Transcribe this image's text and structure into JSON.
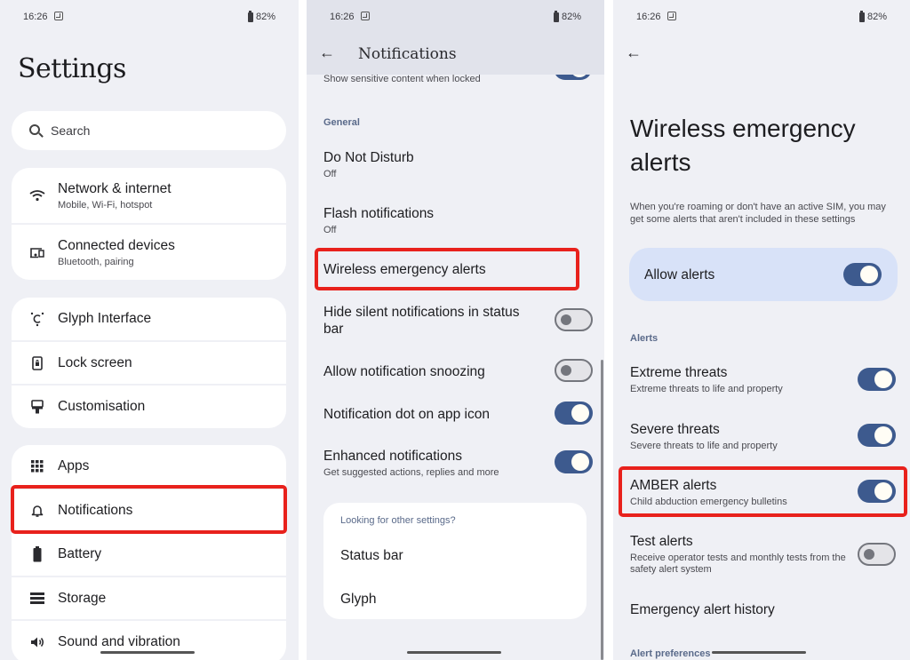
{
  "status_bar": {
    "time": "16:26",
    "battery": "82%"
  },
  "settings_screen": {
    "title": "Settings",
    "search_placeholder": "Search",
    "groups": [
      [
        {
          "icon": "wifi-icon",
          "label": "Network & internet",
          "sub": "Mobile, Wi-Fi, hotspot"
        },
        {
          "icon": "connected-devices-icon",
          "label": "Connected devices",
          "sub": "Bluetooth, pairing"
        }
      ],
      [
        {
          "icon": "glyph-icon",
          "label": "Glyph Interface"
        },
        {
          "icon": "lock-screen-icon",
          "label": "Lock screen"
        },
        {
          "icon": "brush-icon",
          "label": "Customisation"
        }
      ],
      [
        {
          "icon": "apps-grid-icon",
          "label": "Apps"
        },
        {
          "icon": "bell-icon",
          "label": "Notifications",
          "highlighted": true
        },
        {
          "icon": "battery-icon",
          "label": "Battery"
        },
        {
          "icon": "storage-icon",
          "label": "Storage"
        },
        {
          "icon": "speaker-icon",
          "label": "Sound and vibration"
        }
      ]
    ]
  },
  "notifications_screen": {
    "title": "Notifications",
    "partial_row_sub": "Show sensitive content when locked",
    "partial_row_toggle": true,
    "section_general": "General",
    "rows": [
      {
        "title": "Do Not Disturb",
        "sub": "Off"
      },
      {
        "title": "Flash notifications",
        "sub": "Off"
      },
      {
        "title": "Wireless emergency alerts",
        "highlighted": true
      },
      {
        "title": "Hide silent notifications in status bar",
        "toggle": false
      },
      {
        "title": "Allow notification snoozing",
        "toggle": false
      },
      {
        "title": "Notification dot on app icon",
        "toggle": true
      },
      {
        "title": "Enhanced notifications",
        "sub": "Get suggested actions, replies and more",
        "toggle": true
      }
    ],
    "other_settings": {
      "label": "Looking for other settings?",
      "links": [
        "Status bar",
        "Glyph"
      ]
    }
  },
  "wea_screen": {
    "title": "Wireless emergency alerts",
    "description": "When you're roaming or don't have an active SIM, you may get some alerts that aren't included in these settings",
    "allow_alerts": {
      "label": "Allow alerts",
      "on": true
    },
    "section_alerts": "Alerts",
    "rows": [
      {
        "title": "Extreme threats",
        "sub": "Extreme threats to life and property",
        "toggle": true
      },
      {
        "title": "Severe threats",
        "sub": "Severe threats to life and property",
        "toggle": true
      },
      {
        "title": "AMBER alerts",
        "sub": "Child abduction emergency bulletins",
        "toggle": true,
        "highlighted": true
      },
      {
        "title": "Test alerts",
        "sub": "Receive operator tests and monthly tests from the safety alert system",
        "toggle": false
      },
      {
        "title": "Emergency alert history"
      }
    ],
    "section_preferences": "Alert preferences"
  },
  "colors": {
    "highlight": "#e8211c",
    "toggle_on": "#3d5a8e",
    "background": "#eff0f5",
    "allow_card": "#d8e2f8"
  }
}
